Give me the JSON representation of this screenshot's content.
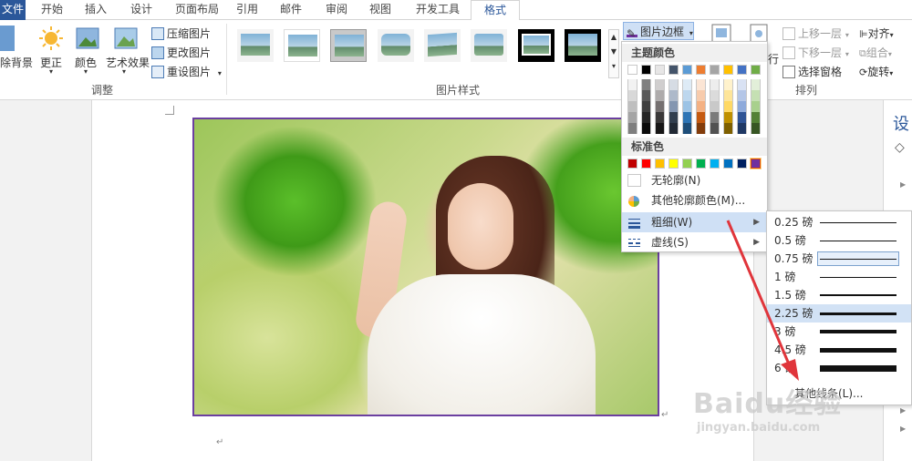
{
  "tabs": [
    {
      "label": "文件"
    },
    {
      "label": "开始"
    },
    {
      "label": "插入"
    },
    {
      "label": "设计"
    },
    {
      "label": "页面布局"
    },
    {
      "label": "引用"
    },
    {
      "label": "邮件"
    },
    {
      "label": "审阅"
    },
    {
      "label": "视图"
    },
    {
      "label": "开发工具"
    },
    {
      "label": "格式"
    }
  ],
  "ribbon": {
    "adjust": {
      "remove_bg": "除背景",
      "correct": "更正",
      "color": "颜色",
      "art_effects": "艺术效果",
      "compress": "压缩图片",
      "change": "更改图片",
      "reset": "重设图片",
      "group_label": "调整"
    },
    "styles": {
      "group_label": "图片样式",
      "border_button": "图片边框",
      "row_label": "行"
    },
    "arrange": {
      "bring_forward": "上移一层",
      "send_backward": "下移一层",
      "selection_pane": "选择窗格",
      "align": "对齐",
      "group": "组合",
      "rotate": "旋转",
      "group_label": "排列"
    }
  },
  "outline_menu": {
    "theme_colors_header": "主题颜色",
    "standard_colors_header": "标准色",
    "theme_top_row": [
      "#ffffff",
      "#000000",
      "#e7e6e6",
      "#44546a",
      "#5b9bd5",
      "#ed7d31",
      "#a5a5a5",
      "#ffc000",
      "#4472c4",
      "#70ad47"
    ],
    "theme_shades": [
      [
        "#f2f2f2",
        "#7f7f7f",
        "#d0cece",
        "#d6dce4",
        "#deebf6",
        "#fbe5d5",
        "#ededed",
        "#fff2cc",
        "#d9e2f3",
        "#e2efd9"
      ],
      [
        "#d8d8d8",
        "#595959",
        "#aeabab",
        "#adb9ca",
        "#bdd7ee",
        "#f7cbac",
        "#dbdbdb",
        "#fee599",
        "#b4c6e7",
        "#c5e0b3"
      ],
      [
        "#bfbfbf",
        "#3f3f3f",
        "#757070",
        "#8496b0",
        "#9cc3e5",
        "#f4b183",
        "#c9c9c9",
        "#ffd965",
        "#8eaadb",
        "#a8d08d"
      ],
      [
        "#a5a5a5",
        "#262626",
        "#3a3838",
        "#323f4f",
        "#2e75b5",
        "#c55a11",
        "#7b7b7b",
        "#bf9000",
        "#2f5496",
        "#538135"
      ],
      [
        "#7f7f7f",
        "#0c0c0c",
        "#171616",
        "#222a35",
        "#1e4e79",
        "#833c0b",
        "#525252",
        "#7f6000",
        "#1f3864",
        "#375623"
      ]
    ],
    "standard_colors": [
      "#c00000",
      "#ff0000",
      "#ffc000",
      "#ffff00",
      "#92d050",
      "#00b050",
      "#00b0f0",
      "#0070c0",
      "#002060",
      "#7030a0"
    ],
    "no_outline": "无轮廓(N)",
    "more_colors": "其他轮廓颜色(M)...",
    "weight": "粗细(W)",
    "dashes": "虚线(S)"
  },
  "weight_submenu": {
    "options": [
      {
        "label": "0.25 磅",
        "weight_pt": 0.25
      },
      {
        "label": "0.5 磅",
        "weight_pt": 0.5
      },
      {
        "label": "0.75 磅",
        "weight_pt": 0.75
      },
      {
        "label": "1 磅",
        "weight_pt": 1
      },
      {
        "label": "1.5 磅",
        "weight_pt": 1.5
      },
      {
        "label": "2.25 磅",
        "weight_pt": 2.25
      },
      {
        "label": "3 磅",
        "weight_pt": 3
      },
      {
        "label": "4.5 磅",
        "weight_pt": 4.5
      },
      {
        "label": "6 磅",
        "weight_pt": 6
      }
    ],
    "more_lines": "其他线条(L)...",
    "selected": "0.75 磅",
    "highlighted": "2.25 磅"
  },
  "right_pane": {
    "title": "设"
  },
  "watermark": {
    "brand": "Baidu经验",
    "url": "jingyan.baidu.com"
  },
  "colors": {
    "accent": "#2b579a",
    "photo_border": "#6b3fa0",
    "arrow": "#e0353b"
  }
}
